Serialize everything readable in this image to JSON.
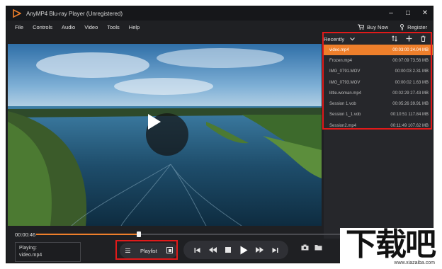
{
  "window": {
    "title": "AnyMP4 Blu-ray Player (Unregistered)",
    "minimize": "–",
    "maximize": "□",
    "close": "✕"
  },
  "menu": {
    "items": [
      "File",
      "Controls",
      "Audio",
      "Video",
      "Tools",
      "Help"
    ],
    "buy_now": "Buy Now",
    "register": "Register"
  },
  "panel": {
    "recent_label": "Recently",
    "items": [
      {
        "name": "video.mp4",
        "meta": "00:03:00 24.04 MB",
        "active": true
      },
      {
        "name": "Frozen.mp4",
        "meta": "00:07:09 73.56 MB",
        "active": false
      },
      {
        "name": "IMG_0791.MOV",
        "meta": "00:00:03 2.31 MB",
        "active": false
      },
      {
        "name": "IMG_0793.MOV",
        "meta": "00:00:02 1.63 MB",
        "active": false
      },
      {
        "name": "little.woman.mp4",
        "meta": "00:02:29 27.43 MB",
        "active": false
      },
      {
        "name": "Session 1.vob",
        "meta": "00:05:26 39.91 MB",
        "active": false
      },
      {
        "name": "Session 1_1.vob",
        "meta": "00:10:51 117.84 MB",
        "active": false
      },
      {
        "name": "Session2.mp4",
        "meta": "00:11:49 107.62 MB",
        "active": false
      }
    ]
  },
  "player": {
    "current_time": "00:00:46",
    "progress": 0.26
  },
  "now_playing": {
    "label": "Playing:",
    "file": "video.mp4"
  },
  "controls": {
    "playlist_label": "Playlist"
  },
  "watermark": {
    "text": "下载吧",
    "url": "www.xiazaiba.com"
  },
  "colors": {
    "accent": "#ee7f2b",
    "highlight_box": "#e11a1a",
    "background": "#1f2023"
  }
}
